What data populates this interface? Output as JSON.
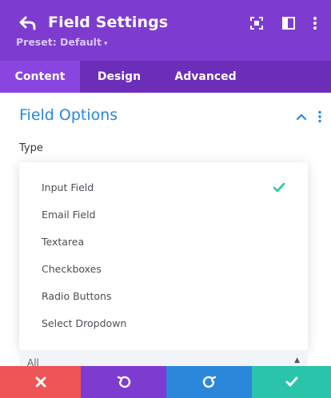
{
  "header": {
    "title": "Field Settings",
    "preset_label": "Preset: Default",
    "icons": [
      "back-arrow-icon",
      "focus-mode-icon",
      "sidebar-layout-icon",
      "more-options-icon"
    ]
  },
  "tabs": [
    {
      "label": "Content",
      "active": true
    },
    {
      "label": "Design",
      "active": false
    },
    {
      "label": "Advanced",
      "active": false
    }
  ],
  "section": {
    "title": "Field Options",
    "type_label": "Type"
  },
  "type_dropdown": {
    "options": [
      {
        "label": "Input Field",
        "selected": true
      },
      {
        "label": "Email Field",
        "selected": false
      },
      {
        "label": "Textarea",
        "selected": false
      },
      {
        "label": "Checkboxes",
        "selected": false
      },
      {
        "label": "Radio Buttons",
        "selected": false
      },
      {
        "label": "Select Dropdown",
        "selected": false
      }
    ]
  },
  "next_select": {
    "value": "All"
  },
  "footer": {
    "buttons": [
      "close-icon",
      "undo-icon",
      "redo-icon",
      "save-check-icon"
    ]
  },
  "colors": {
    "header_bg": "#7e3bd0",
    "tabs_bg": "#6c2eb9",
    "active_tab_bg": "#8a45e0",
    "accent_blue": "#2b87da",
    "check_green": "#29c4a9",
    "footer_red": "#ef5555",
    "footer_purple": "#7e3bd0",
    "footer_blue": "#2b87da",
    "footer_green": "#29c4a9"
  }
}
